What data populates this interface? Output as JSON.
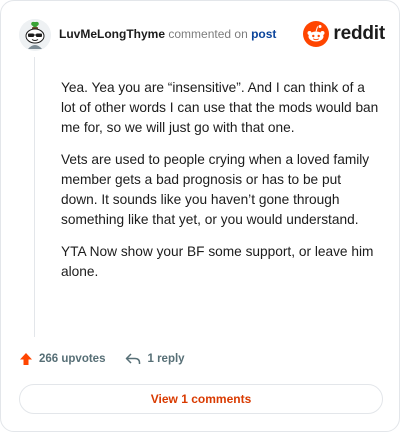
{
  "header": {
    "author": "LuvMeLongThyme",
    "action_text": "commented on",
    "post_link": "post",
    "brand_word": "reddit"
  },
  "comment": {
    "paragraphs": [
      "Yea. Yea you are “insensitive”. And I can think of a lot of other words I can use that the mods would ban me for, so we will just go with that one.",
      "Vets are used to people crying when a loved family member gets a bad prognosis or has to be put down. It sounds like you haven’t gone through something like that yet, or you would understand.",
      "YTA Now show your BF some support, or leave him alone."
    ]
  },
  "actions": {
    "upvotes_label": "266 upvotes",
    "reply_label": "1 reply"
  },
  "footer": {
    "view_label": "View 1 comments"
  },
  "colors": {
    "brand_orange": "#ff4500",
    "link_blue": "#0a449b",
    "meta_gray": "#576f76",
    "view_button_text": "#d93a00"
  },
  "icons": {
    "avatar": "snoo-avatar-with-sunglasses-and-plant-hat",
    "brand": "reddit-snoo-logo",
    "upvote": "upvote-arrow-icon",
    "reply": "reply-arrow-icon"
  }
}
